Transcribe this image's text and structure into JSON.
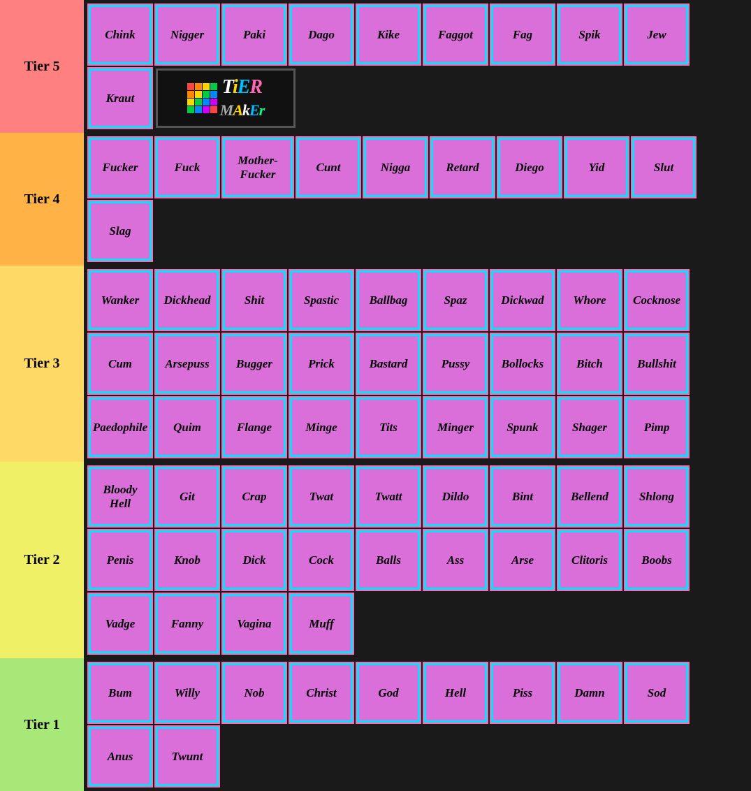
{
  "tiers": [
    {
      "id": "tier5",
      "label": "Tier 5",
      "bg_class": "tier-5-bg",
      "words": [
        "Chink",
        "Nigger",
        "Paki",
        "Dago",
        "Kike",
        "Faggot",
        "Fag",
        "Spik",
        "Jew",
        "Kraut"
      ]
    },
    {
      "id": "tier4",
      "label": "Tier 4",
      "bg_class": "tier-4-bg",
      "words": [
        "Fucker",
        "Fuck",
        "Mother-Fucker",
        "Cunt",
        "Nigga",
        "Retard",
        "Diego",
        "Yid",
        "Slut",
        "Slag"
      ]
    },
    {
      "id": "tier3",
      "label": "Tier 3",
      "bg_class": "tier-3-bg",
      "words": [
        "Wanker",
        "Dickhead",
        "Shit",
        "Spastic",
        "Ballbag",
        "Spaz",
        "Dickwad",
        "Whore",
        "Cocknose",
        "Cum",
        "Arsepuss",
        "Bugger",
        "Prick",
        "Bastard",
        "Pussy",
        "Bollocks",
        "Bitch",
        "Bullshit",
        "Paedophile",
        "Quim",
        "Flange",
        "Minge",
        "Tits",
        "Minger",
        "Spunk",
        "Shager",
        "Pimp"
      ]
    },
    {
      "id": "tier2",
      "label": "Tier 2",
      "bg_class": "tier-2-bg",
      "words": [
        "Bloody Hell",
        "Git",
        "Crap",
        "Twat",
        "Twatt",
        "Dildo",
        "Bint",
        "Bellend",
        "Shlong",
        "Penis",
        "Knob",
        "Dick",
        "Cock",
        "Balls",
        "Ass",
        "Arse",
        "Clitoris",
        "Boobs",
        "Vadge",
        "Fanny",
        "Vagina",
        "Muff"
      ]
    },
    {
      "id": "tier1",
      "label": "Tier 1",
      "bg_class": "tier-1-bg",
      "words": [
        "Bum",
        "Willy",
        "Nob",
        "Christ",
        "God",
        "Hell",
        "Piss",
        "Damn",
        "Sod",
        "Anus",
        "Twunt"
      ]
    }
  ],
  "logo": {
    "tier_text": "TiER",
    "maker_text": "MAkEr"
  }
}
